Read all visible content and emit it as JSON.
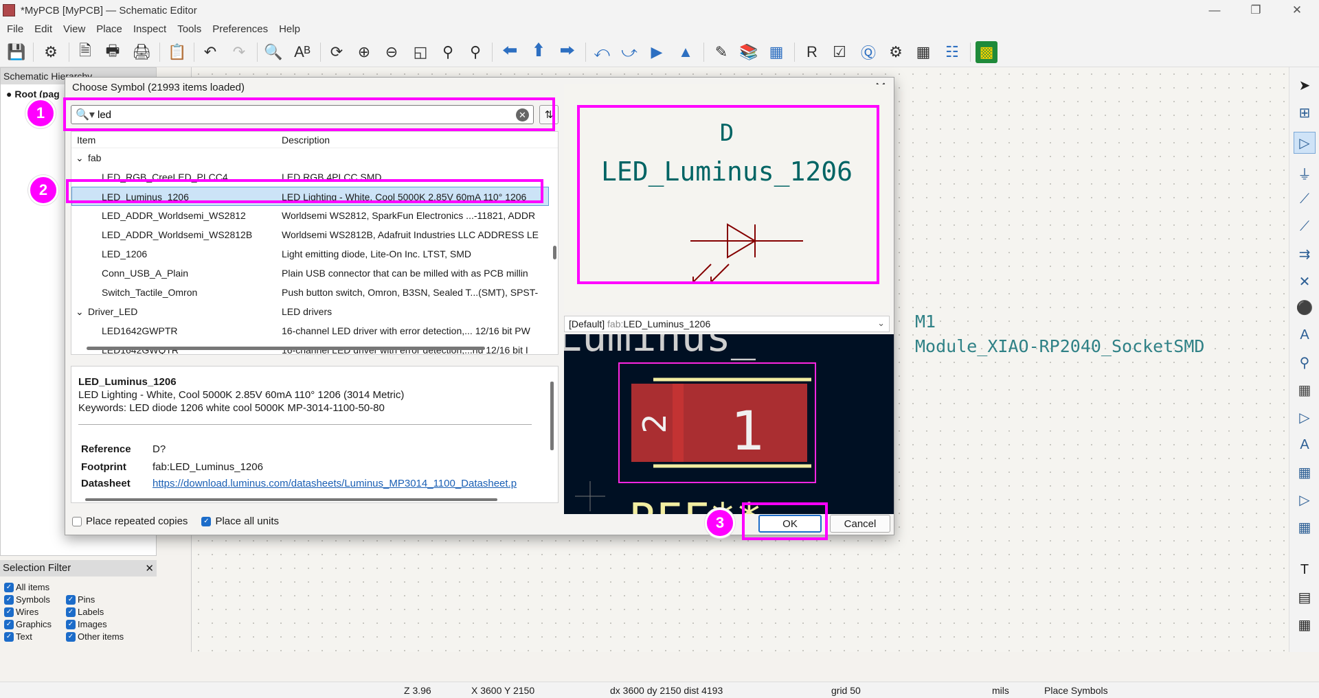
{
  "window": {
    "title": "*MyPCB [MyPCB] — Schematic Editor",
    "controls": [
      "—",
      "❐",
      "✕"
    ]
  },
  "menu": [
    "File",
    "Edit",
    "View",
    "Place",
    "Inspect",
    "Tools",
    "Preferences",
    "Help"
  ],
  "left_panel": {
    "hierarchy_title": "Schematic Hierarchy",
    "root_label": "Root (pag"
  },
  "selection_filter": {
    "title": "Selection Filter",
    "close": "✕",
    "items": [
      {
        "label": "All items",
        "checked": true
      },
      {
        "label": "Symbols",
        "checked": true
      },
      {
        "label": "Pins",
        "checked": true
      },
      {
        "label": "Wires",
        "checked": true
      },
      {
        "label": "Labels",
        "checked": true
      },
      {
        "label": "Graphics",
        "checked": true
      },
      {
        "label": "Images",
        "checked": true
      },
      {
        "label": "Text",
        "checked": true
      },
      {
        "label": "Other items",
        "checked": true
      }
    ]
  },
  "canvas": {
    "m1_reference": "M1",
    "m1_value": "Module_XIAO-RP2040_SocketSMD"
  },
  "dialog": {
    "title": "Choose Symbol (21993 items loaded)",
    "close": "✕",
    "search_value": "led",
    "columns": {
      "item": "Item",
      "description": "Description"
    },
    "library_fab": "fab",
    "rows": [
      {
        "item": "LED_RGB_CreeLED_PLCC4",
        "desc": "LED RGB 4PLCC SMD"
      },
      {
        "item": "LED_Luminus_1206",
        "desc": "LED Lighting - White, Cool 5000K 2.85V 60mA 110° 1206"
      },
      {
        "item": "LED_ADDR_Worldsemi_WS2812",
        "desc": "Worldsemi WS2812, SparkFun Electronics ...-11821, ADDR"
      },
      {
        "item": "LED_ADDR_Worldsemi_WS2812B",
        "desc": "Worldsemi WS2812B, Adafruit Industries LLC ADDRESS LE"
      },
      {
        "item": "LED_1206",
        "desc": "Light emitting diode, Lite-On Inc. LTST, SMD"
      },
      {
        "item": "Conn_USB_A_Plain",
        "desc": "Plain USB connector that can be milled with as PCB millin"
      },
      {
        "item": "Switch_Tactile_Omron",
        "desc": "Push button switch, Omron, B3SN, Sealed T...(SMT), SPST-"
      }
    ],
    "library_driver": "Driver_LED",
    "library_driver_desc": "LED drivers",
    "driver_rows": [
      {
        "item": "LED1642GWPTR",
        "desc": "16-channel LED driver with error detection,... 12/16 bit PW"
      },
      {
        "item": "LED1642GWQTR",
        "desc": "16-channel LED driver with error detection,...nd 12/16 bit I"
      }
    ],
    "details": {
      "name": "LED_Luminus_1206",
      "description": "LED Lighting - White, Cool 5000K 2.85V 60mA 110° 1206 (3014 Metric)",
      "keywords": "Keywords: LED diode 1206 white cool 5000K MP-3014-1100-50-80",
      "reference_label": "Reference",
      "reference_value": "D?",
      "footprint_label": "Footprint",
      "footprint_value": "fab:LED_Luminus_1206",
      "datasheet_label": "Datasheet",
      "datasheet_value": "https://download.luminus.com/datasheets/Luminus_MP3014_1100_Datasheet.p"
    },
    "preview": {
      "ref": "D",
      "value": "LED_Luminus_1206"
    },
    "footprint_select": {
      "prefix": "[Default] ",
      "lib": "fab:",
      "name": "LED_Luminus_1206"
    },
    "footprint_preview": {
      "pad1": "1",
      "pad2": "2",
      "ghost_text_top": "Luminus_",
      "ghost_text_bottom": "REF**"
    },
    "options": {
      "repeated": {
        "label": "Place repeated copies",
        "checked": false
      },
      "all_units": {
        "label": "Place all units",
        "checked": true
      }
    },
    "ok": "OK",
    "cancel": "Cancel"
  },
  "annotations": [
    "1",
    "2",
    "3"
  ],
  "status": {
    "zoom": "Z 3.96",
    "xy": "X 3600  Y 2150",
    "delta": "dx 3600  dy 2150  dist 4193",
    "grid": "grid 50",
    "units": "mils",
    "mode": "Place Symbols"
  },
  "colors": {
    "highlight": "#ff00ff",
    "schematic_symbol": "#840000",
    "schematic_text": "#006464",
    "pcb_background": "#001023",
    "pad_red": "#c83434",
    "silkscreen": "#f2eda1",
    "courtyard": "#ff26e2"
  }
}
